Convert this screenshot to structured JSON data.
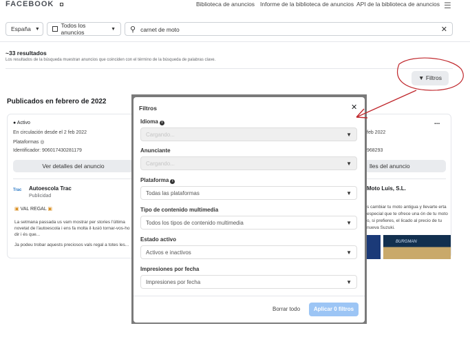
{
  "header": {
    "logo": "FACEBOOK",
    "nav": [
      "Biblioteca de anuncios",
      "Informe de la biblioteca de anuncios",
      "API de la biblioteca de anuncios"
    ]
  },
  "search": {
    "country": "España",
    "ad_type": "Todos los anuncios",
    "query": "carnet de moto"
  },
  "results": {
    "count": "~33 resultados",
    "description": "Los resultados de la búsqueda muestran anuncios que coinciden con el término de la búsqueda de palabras clave.",
    "filters_button": "Filtros",
    "section_title": "Publicados en febrero de 2022"
  },
  "cards": [
    {
      "status": "Activo",
      "since": "En circulación desde el 2 feb 2022",
      "platforms": "Plataformas",
      "id": "Identificador: 906017430281179",
      "details": "Ver detalles del anuncio",
      "advertiser": "Autoescola Trac",
      "sponsored": "Publicidad",
      "logo_text": "Trac",
      "headline": "VAL REGAL",
      "body": "La setmana passada us vam mostrar per stories l'última novetat de l'autoescola i ens fa molta il·lusió tornar-vos-ho dir i és que...",
      "body2": "Ja podeu trobar aquests preciosos vals regal a totes les..."
    },
    {
      "since": "feb 2022",
      "id": "968293",
      "details": "lles del anuncio",
      "advertiser": "Moto Luis, S.L.",
      "more": "...",
      "body": "s cambiar tu moto antigua y llevarte erta especial que te ofrece una ón de tu moto o, si prefieres, el licado al precio de tu nueva Suzuki.",
      "banner": "BURGMAN"
    }
  ],
  "modal": {
    "title": "Filtros",
    "fields": [
      {
        "label": "Idioma",
        "value": "Cargando...",
        "disabled": true,
        "info": true
      },
      {
        "label": "Anunciante",
        "value": "Cargando...",
        "disabled": true
      },
      {
        "label": "Plataforma",
        "value": "Todas las plataformas",
        "info": true
      },
      {
        "label": "Tipo de contenido multimedia",
        "value": "Todos los tipos de contenido multimedia"
      },
      {
        "label": "Estado activo",
        "value": "Activos e inactivos"
      },
      {
        "label": "Impresiones por fecha",
        "value": "Impresiones por fecha"
      }
    ],
    "clear": "Borrar todo",
    "apply": "Aplicar 0 filtros"
  },
  "colors": {
    "annotation": "#c0282d",
    "apply_button": "#9cc5f5"
  }
}
